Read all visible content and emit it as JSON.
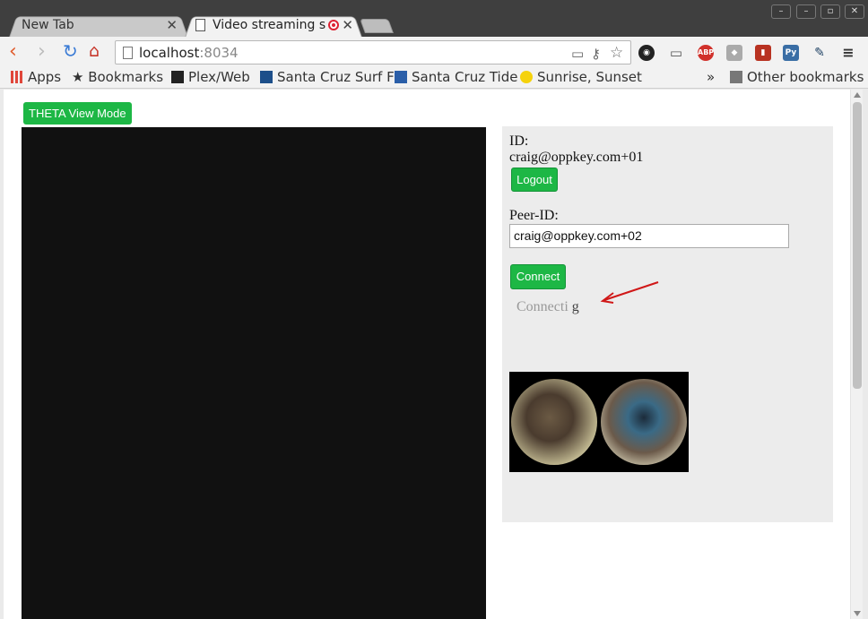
{
  "browser": {
    "tabs": [
      {
        "title": "New Tab",
        "active": false
      },
      {
        "title": "Video streaming s",
        "active": true
      }
    ],
    "url_host": "localhost",
    "url_port": ":8034",
    "bookmarks": [
      {
        "label": "Apps",
        "icon": "apps-grid-icon"
      },
      {
        "label": "Bookmarks",
        "icon": "star-icon"
      },
      {
        "label": "Plex/Web",
        "icon": "plex-icon"
      },
      {
        "label": "Santa Cruz Surf F",
        "icon": "surf-icon"
      },
      {
        "label": "Santa Cruz Tide",
        "icon": "tide-icon"
      },
      {
        "label": "Sunrise, Sunset C",
        "icon": "sun-icon"
      }
    ],
    "bookmarks_overflow": "»",
    "other_bookmarks": "Other bookmarks"
  },
  "page": {
    "theta_button": "THETA View Mode",
    "id_label": "ID:",
    "id_value": "craig@oppkey.com+01",
    "logout_button": "Logout",
    "peer_label": "Peer-ID:",
    "peer_value": "craig@oppkey.com+02",
    "connect_button": "Connect",
    "status_text": "Connecti",
    "status_tail": "g"
  },
  "colors": {
    "accent_green": "#1db745",
    "annotation_arrow": "#d01818"
  }
}
